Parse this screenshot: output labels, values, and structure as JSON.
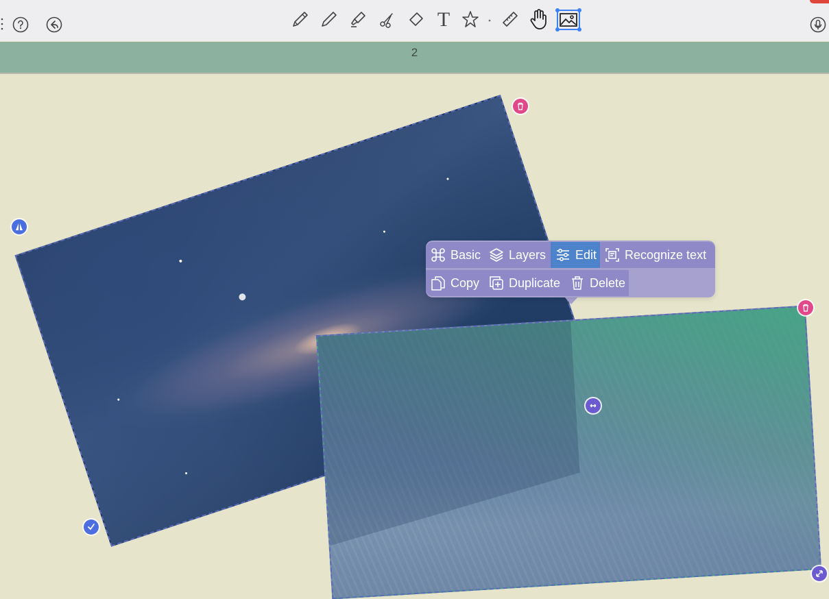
{
  "toolbar": {
    "tools": [
      "pen",
      "pencil",
      "highlighter",
      "scissors",
      "eraser",
      "text",
      "shapes",
      "ruler",
      "hand",
      "image"
    ],
    "text_tool_glyph": "T",
    "active_tool": "image",
    "accent_color": "#3b82f6"
  },
  "page": {
    "number": "2",
    "banner_color": "#8db19f",
    "background_color": "#e6e5cb"
  },
  "context_menu": {
    "row1": [
      {
        "label": "Basic",
        "icon": "command-icon"
      },
      {
        "label": "Layers",
        "icon": "layers-icon"
      },
      {
        "label": "Edit",
        "icon": "sliders-icon"
      },
      {
        "label": "Recognize text",
        "icon": "scan-text-icon"
      }
    ],
    "row2": [
      {
        "label": "Copy",
        "icon": "copy-icon"
      },
      {
        "label": "Duplicate",
        "icon": "duplicate-icon"
      },
      {
        "label": "Delete",
        "icon": "trash-icon"
      }
    ]
  },
  "images": [
    {
      "name": "galaxy",
      "handles": [
        "delete",
        "flip",
        "confirm",
        "resize"
      ]
    },
    {
      "name": "wave",
      "handles": [
        "delete",
        "resize"
      ]
    }
  ]
}
